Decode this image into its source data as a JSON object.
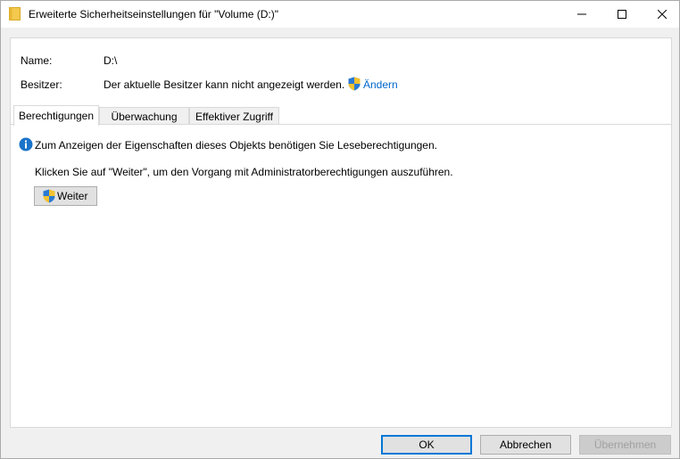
{
  "window": {
    "title": "Erweiterte Sicherheitseinstellungen für \"Volume (D:)\""
  },
  "info": {
    "name_label": "Name:",
    "name_value": "D:\\",
    "owner_label": "Besitzer:",
    "owner_value": "Der aktuelle Besitzer kann nicht angezeigt werden.",
    "change_link": "Ändern"
  },
  "tabs": [
    {
      "label": "Berechtigungen",
      "active": true
    },
    {
      "label": "Überwachung",
      "active": false
    },
    {
      "label": "Effektiver Zugriff",
      "active": false
    }
  ],
  "content": {
    "info_message": "Zum Anzeigen der Eigenschaften dieses Objekts benötigen Sie Leseberechtigungen.",
    "instruction": "Klicken Sie auf \"Weiter\", um den Vorgang mit Administratorberechtigungen auszuführen.",
    "continue_button": "Weiter"
  },
  "footer": {
    "ok": "OK",
    "cancel": "Abbrechen",
    "apply": "Übernehmen"
  },
  "colors": {
    "accent": "#0078d7",
    "link": "#0066cc",
    "folder": "#f3c94e",
    "info": "#1a73c9"
  }
}
